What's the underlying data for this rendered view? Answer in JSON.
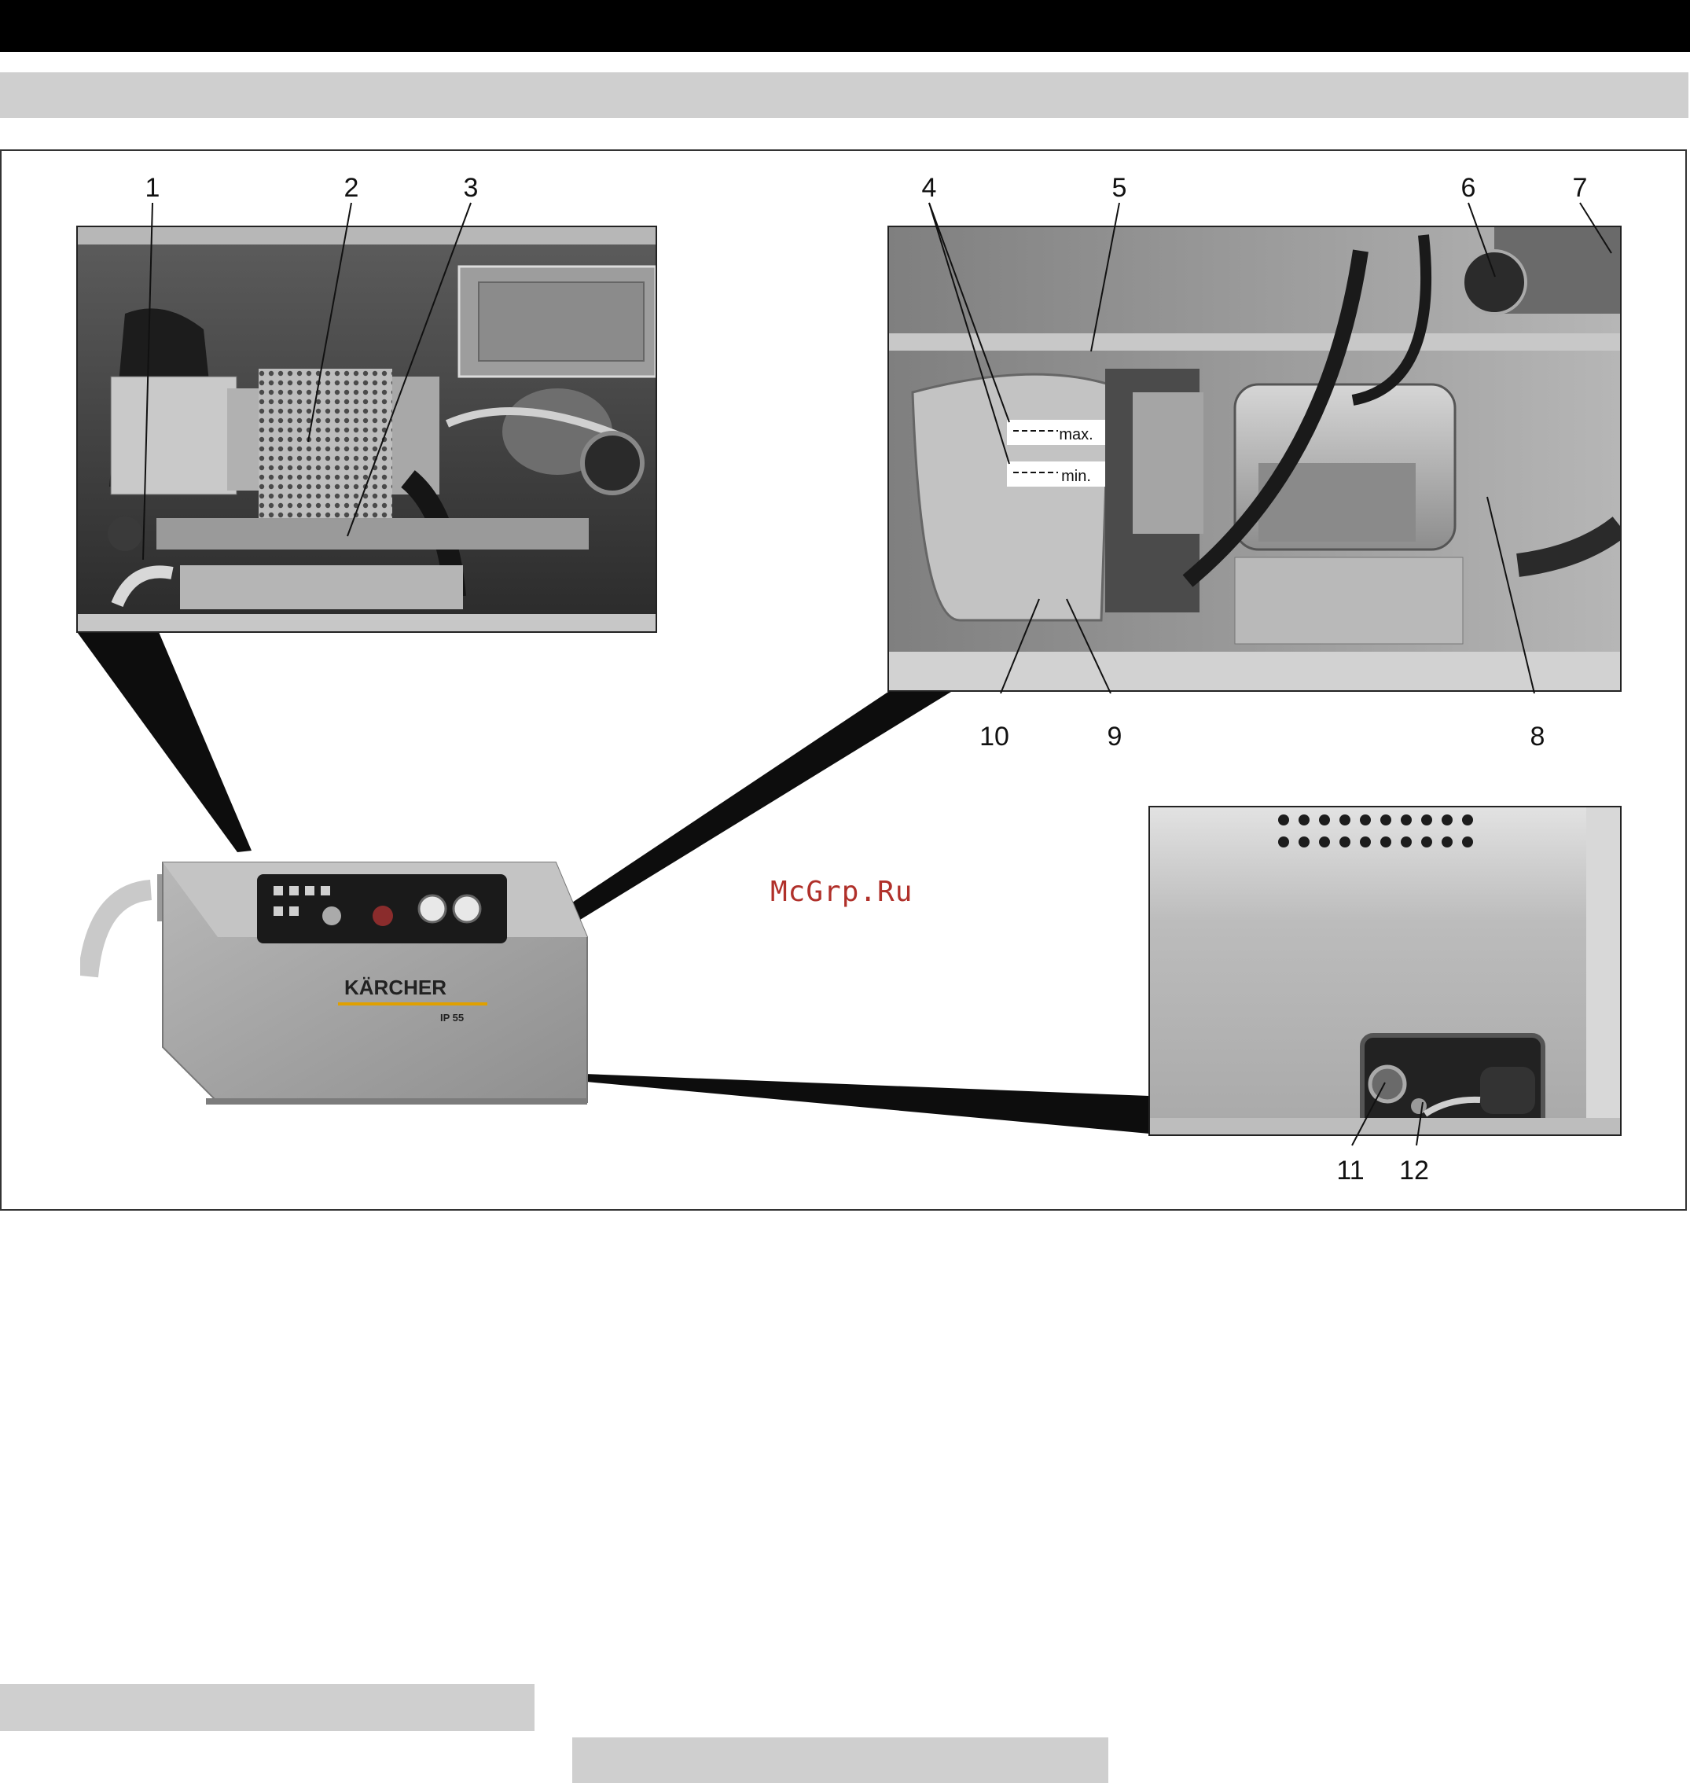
{
  "callouts": {
    "c1": "1",
    "c2": "2",
    "c3": "3",
    "c4": "4",
    "c5": "5",
    "c6": "6",
    "c7": "7",
    "c8": "8",
    "c9": "9",
    "c10": "10",
    "c11": "11",
    "c12": "12"
  },
  "tank_labels": {
    "max": "max.",
    "min": "min."
  },
  "machine": {
    "brand": "KÄRCHER",
    "rating": "IP 55"
  },
  "watermark": "McGrp.Ru",
  "colors": {
    "ink": "#111111",
    "page_band": "#cfcfcf",
    "watermark": "#b0302a"
  }
}
